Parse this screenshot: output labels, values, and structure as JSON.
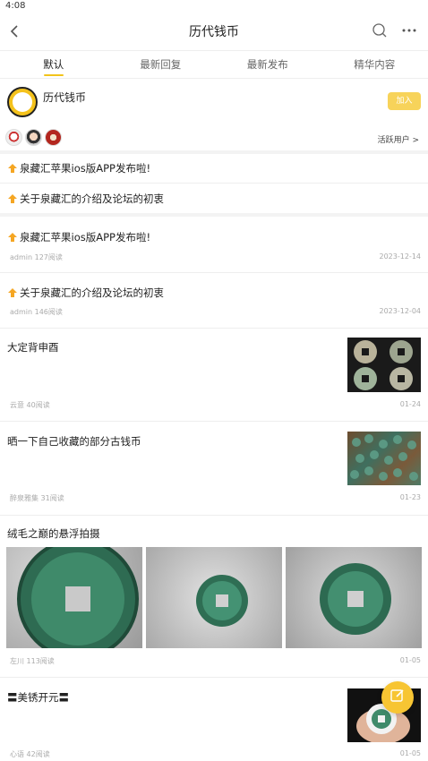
{
  "status": {
    "time": "4:08"
  },
  "nav": {
    "title": "历代钱币"
  },
  "tabs": [
    "默认",
    "最新回复",
    "最新发布",
    "精华内容"
  ],
  "forum": {
    "name": "历代钱币",
    "join_label": "加入",
    "active_users_label": "活跃用户 >"
  },
  "pinned": [
    {
      "title": "泉藏汇苹果ios版APP发布啦!"
    },
    {
      "title": "关于泉藏汇的介绍及论坛的初衷"
    }
  ],
  "posts": [
    {
      "title": "泉藏汇苹果ios版APP发布啦!",
      "meta": "admin 127阅读",
      "date": "2023-12-14"
    },
    {
      "title": "关于泉藏汇的介绍及论坛的初衷",
      "meta": "admin 146阅读",
      "date": "2023-12-04"
    },
    {
      "title": "大定背申酉",
      "meta": "云意 40阅读",
      "date": "01-24"
    },
    {
      "title": "晒一下自己收藏的部分古钱币",
      "meta": "醉泉雅集 31阅读",
      "date": "01-23"
    },
    {
      "title": "绒毛之巅的悬浮拍摄",
      "meta": "左川 113阅读",
      "date": "01-05"
    },
    {
      "title": "〓美锈开元〓",
      "meta": "心语 42阅读",
      "date": "01-05"
    }
  ],
  "colors": {
    "accent": "#f2c31b",
    "join_bg": "#f7d35a",
    "pin_icon": "#f5a623"
  },
  "icons": [
    "back-icon",
    "search-icon",
    "more-icon",
    "pin-icon",
    "edit-icon"
  ]
}
